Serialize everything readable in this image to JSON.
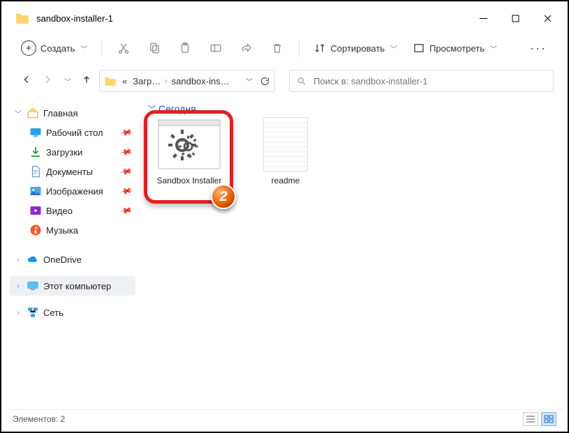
{
  "window": {
    "title": "sandbox-installer-1"
  },
  "toolbar": {
    "create": "Создать",
    "sort": "Сортировать",
    "view": "Просмотреть"
  },
  "breadcrumb": {
    "prefix": "«",
    "part1": "Загр…",
    "part2": "sandbox-ins…"
  },
  "search": {
    "placeholder": "Поиск в: sandbox-installer-1"
  },
  "sidebar": {
    "home": "Главная",
    "quick": [
      "Рабочий стол",
      "Загрузки",
      "Документы",
      "Изображения",
      "Видео",
      "Музыка"
    ],
    "onedrive": "OneDrive",
    "thispc": "Этот компьютер",
    "network": "Сеть"
  },
  "group": {
    "today": "Сегодня"
  },
  "files": {
    "sandbox": "Sandbox Installer",
    "readme": "readme"
  },
  "annotation": {
    "step": "2"
  },
  "status": {
    "count_label": "Элементов:",
    "count": "2"
  }
}
